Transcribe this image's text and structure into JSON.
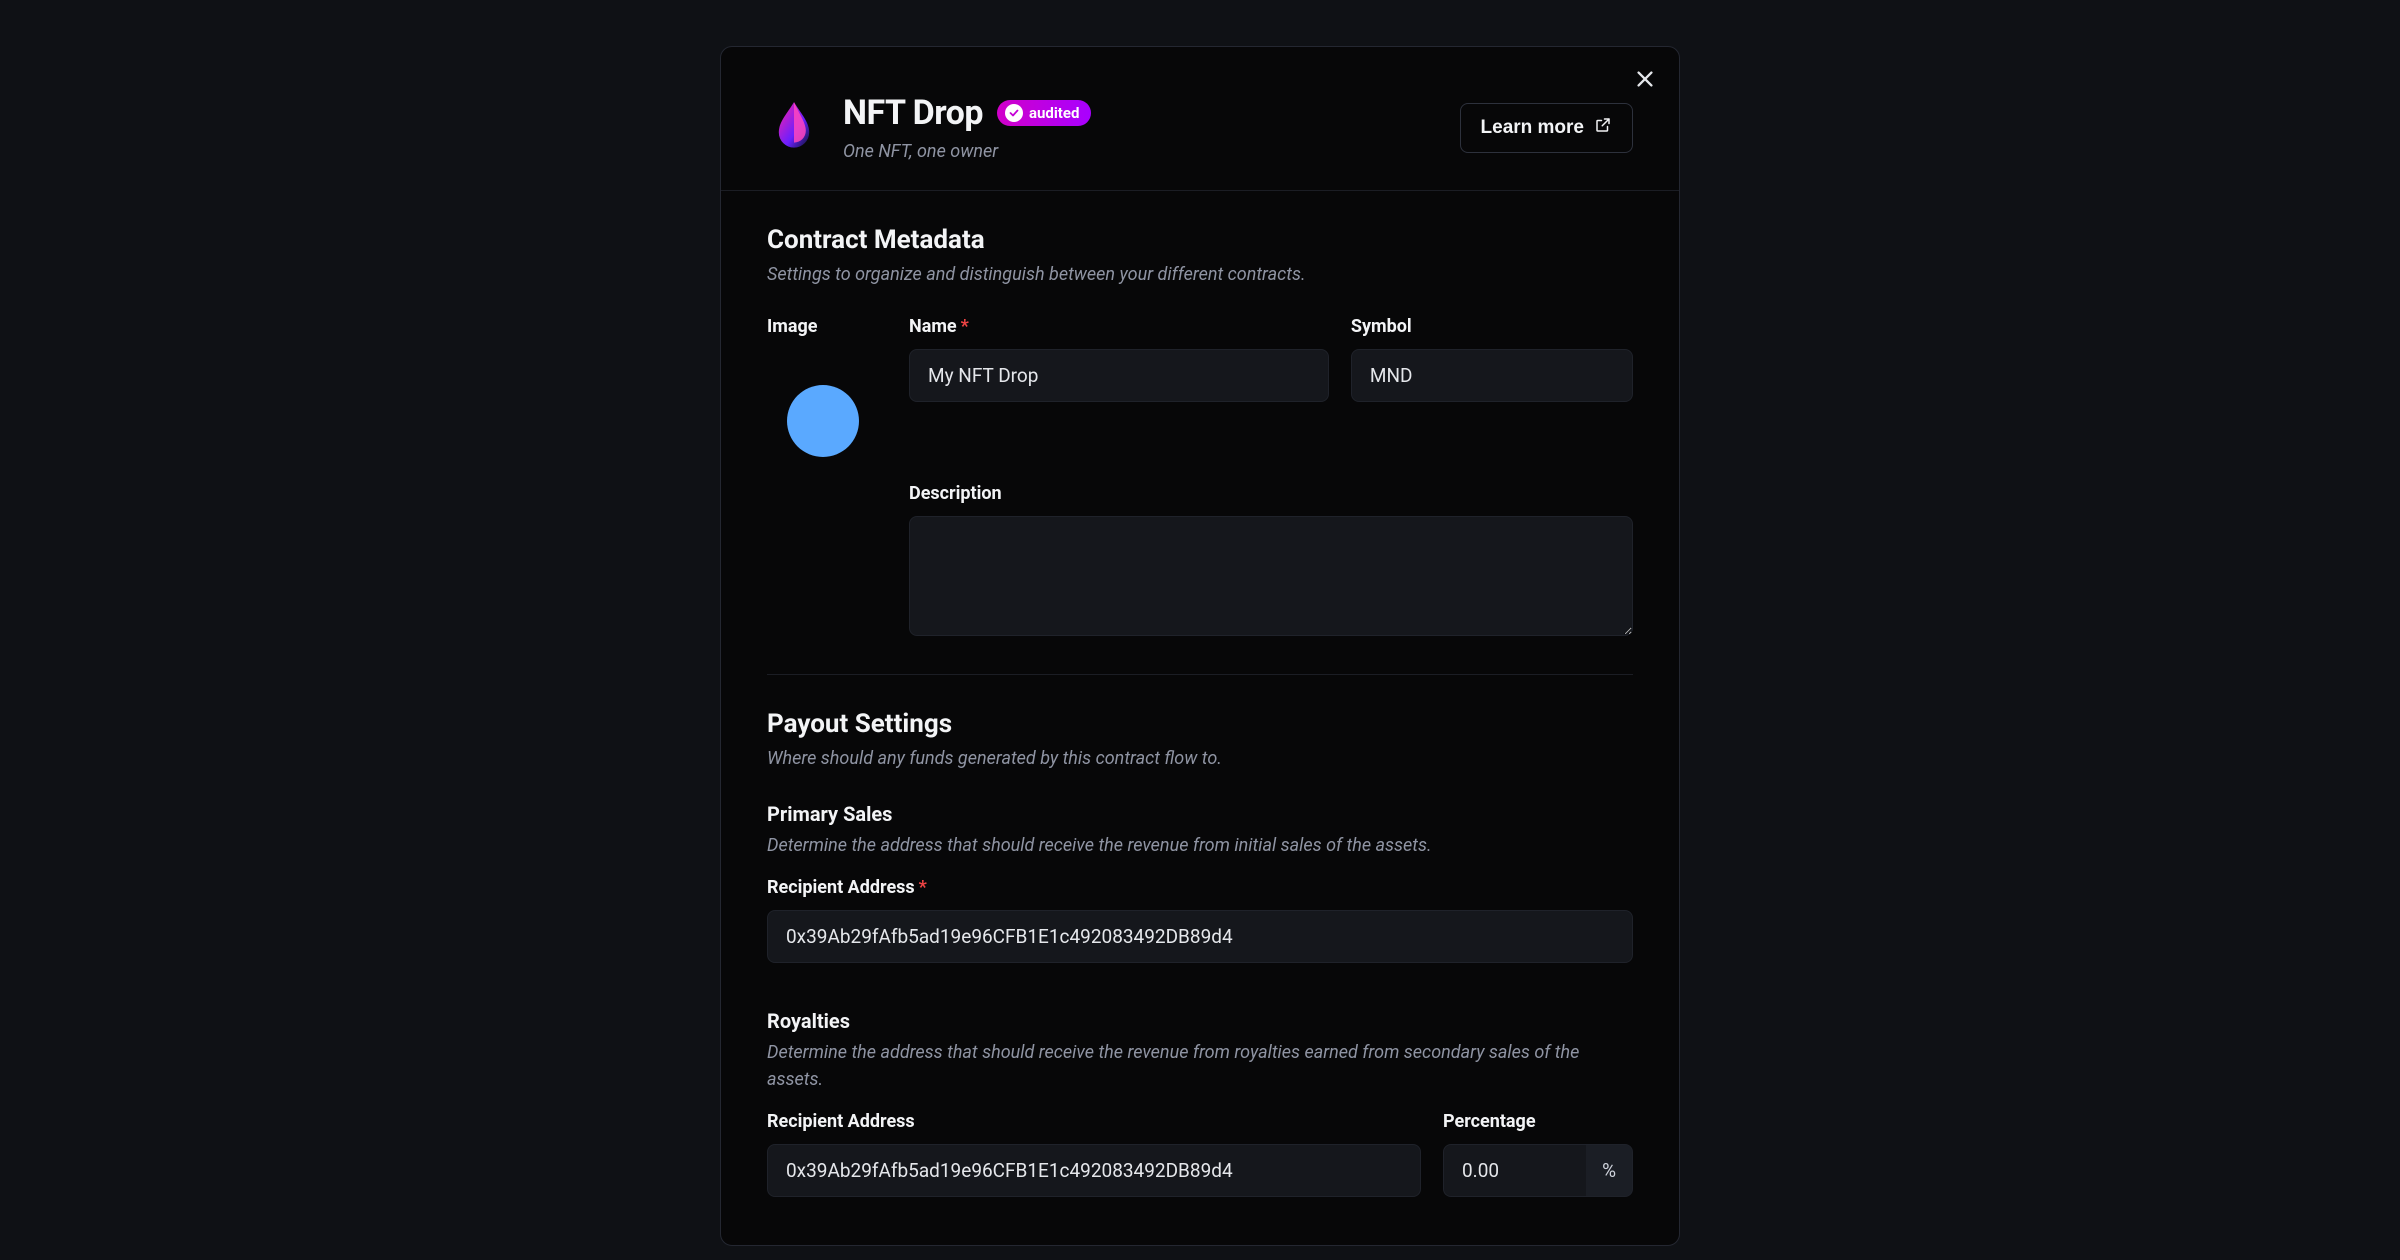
{
  "header": {
    "title": "NFT Drop",
    "badge_text": "audited",
    "subtitle": "One NFT, one owner",
    "learn_more": "Learn more"
  },
  "metadata": {
    "section_title": "Contract Metadata",
    "section_desc": "Settings to organize and distinguish between your different contracts.",
    "image_label": "Image",
    "name_label": "Name",
    "name_value": "My NFT Drop",
    "symbol_label": "Symbol",
    "symbol_value": "MND",
    "description_label": "Description",
    "description_value": ""
  },
  "payout": {
    "section_title": "Payout Settings",
    "section_desc": "Where should any funds generated by this contract flow to.",
    "primary": {
      "title": "Primary Sales",
      "desc": "Determine the address that should receive the revenue from initial sales of the assets.",
      "recipient_label": "Recipient Address",
      "recipient_value": "0x39Ab29fAfb5ad19e96CFB1E1c492083492DB89d4"
    },
    "royalties": {
      "title": "Royalties",
      "desc": "Determine the address that should receive the revenue from royalties earned from secondary sales of the assets.",
      "recipient_label": "Recipient Address",
      "recipient_value": "0x39Ab29fAfb5ad19e96CFB1E1c492083492DB89d4",
      "percentage_label": "Percentage",
      "percentage_value": "0.00",
      "percentage_suffix": "%"
    }
  }
}
